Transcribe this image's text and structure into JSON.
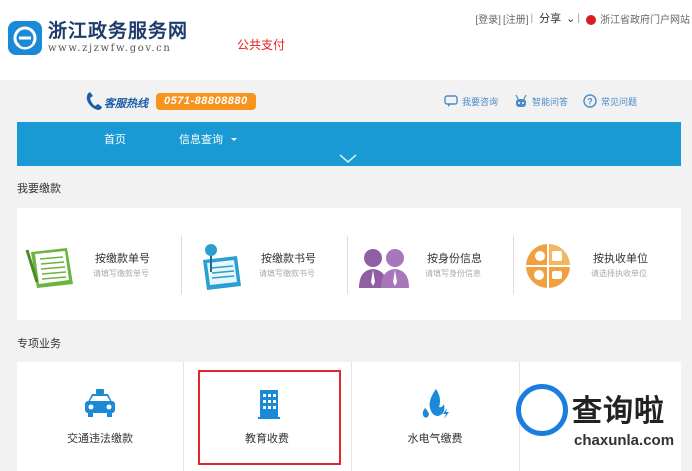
{
  "header": {
    "logo_cn": "浙江政务服务网",
    "logo_en": "www.zjzwfw.gov.cn",
    "page_tag": "公共支付",
    "links": {
      "login": "[登录]",
      "register": "[注册]",
      "share": "分享",
      "portal": "浙江省政府门户网站"
    }
  },
  "hotline": {
    "label": "客服热线",
    "number": "0571-88808880",
    "help_links": [
      {
        "label": "我要咨询",
        "icon": "chat-bubble-icon"
      },
      {
        "label": "智能问答",
        "icon": "robot-icon"
      },
      {
        "label": "常见问题",
        "icon": "question-icon"
      }
    ]
  },
  "nav": {
    "items": [
      {
        "label": "首页"
      },
      {
        "label": "信息查询"
      }
    ]
  },
  "payment_section": {
    "title": "我要缴款",
    "methods": [
      {
        "title": "按缴款单号",
        "hint": "请填写缴款单号",
        "icon": "form-document-icon"
      },
      {
        "title": "按缴款书号",
        "hint": "请填写缴款书号",
        "icon": "pin-document-icon"
      },
      {
        "title": "按身份信息",
        "hint": "请填写身份信息",
        "icon": "people-icon"
      },
      {
        "title": "按执收单位",
        "hint": "请选择执收单位",
        "icon": "agency-chart-icon"
      }
    ]
  },
  "special_section": {
    "title": "专项业务",
    "services": [
      {
        "label": "交通违法缴款",
        "icon": "taxi-icon"
      },
      {
        "label": "教育收费",
        "icon": "building-icon"
      },
      {
        "label": "水电气缴费",
        "icon": "utility-flame-icon"
      },
      {
        "label": "",
        "icon": ""
      }
    ]
  },
  "watermark": {
    "title": "查询啦",
    "url": "chaxunla.com"
  },
  "colors": {
    "nav_blue": "#1a9ad4",
    "hotline_orange": "#f7941d",
    "highlight_red": "#e3262b"
  }
}
